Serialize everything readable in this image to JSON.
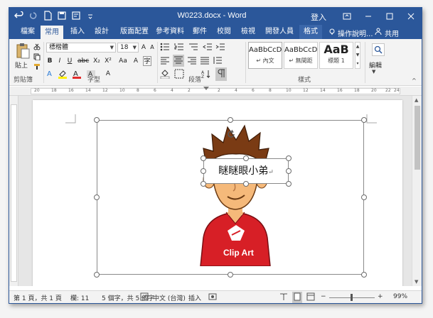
{
  "titlebar": {
    "document_title": "W0223.docx - Word",
    "sign_in": "登入",
    "quick_access": [
      "undo-icon",
      "redo-icon",
      "new-doc-icon",
      "save-icon",
      "print-preview-icon",
      "customize-icon"
    ],
    "window_buttons": [
      "ribbon-display-icon",
      "minimize-icon",
      "maximize-icon",
      "close-icon"
    ]
  },
  "tabs": {
    "items": [
      "檔案",
      "常用",
      "插入",
      "設計",
      "版面配置",
      "參考資料",
      "郵件",
      "校閱",
      "檢視",
      "開發人員",
      "格式"
    ],
    "active": "常用",
    "tell_me": "操作說明...",
    "share": "共用"
  },
  "ribbon": {
    "clipboard": {
      "paste_label": "貼上",
      "group_label": "剪貼簿"
    },
    "font": {
      "font_name": "標楷體",
      "font_size": "18",
      "group_label": "字型",
      "buttons": [
        "B",
        "I",
        "U",
        "abc",
        "X₂",
        "X²",
        "A",
        "A",
        "Aa",
        "A",
        "A",
        "字"
      ]
    },
    "paragraph": {
      "group_label": "段落"
    },
    "styles": {
      "group_label": "樣式",
      "items": [
        {
          "sample": "AaBbCcD",
          "name": "↵ 內文"
        },
        {
          "sample": "AaBbCcD",
          "name": "↵ 無間距"
        },
        {
          "sample": "AaB",
          "name": "標題 1"
        }
      ]
    },
    "editing": {
      "label": "編輯"
    }
  },
  "ruler": {
    "ticks": [
      "20",
      "18",
      "16",
      "14",
      "12",
      "10",
      "8",
      "6",
      "4",
      "2",
      "2",
      "4",
      "6",
      "8",
      "10",
      "12",
      "14",
      "16",
      "18",
      "20",
      "22",
      "24"
    ]
  },
  "document": {
    "textbox_text": "瞇瞇眼小弟",
    "paragraph_mark": "↵",
    "clipart_banner": "Clip Art"
  },
  "statusbar": {
    "page": "第 1 頁，共 1 頁",
    "section": "欄: 11",
    "words": "5 個字，共 5 個字",
    "language": "中文 (台灣)",
    "insert_mode": "插入",
    "zoom": "99%"
  },
  "colors": {
    "accent": "#2b579a",
    "shirt_red": "#d71f26",
    "hair_brown": "#7a3b14",
    "skin": "#f5b97a"
  }
}
